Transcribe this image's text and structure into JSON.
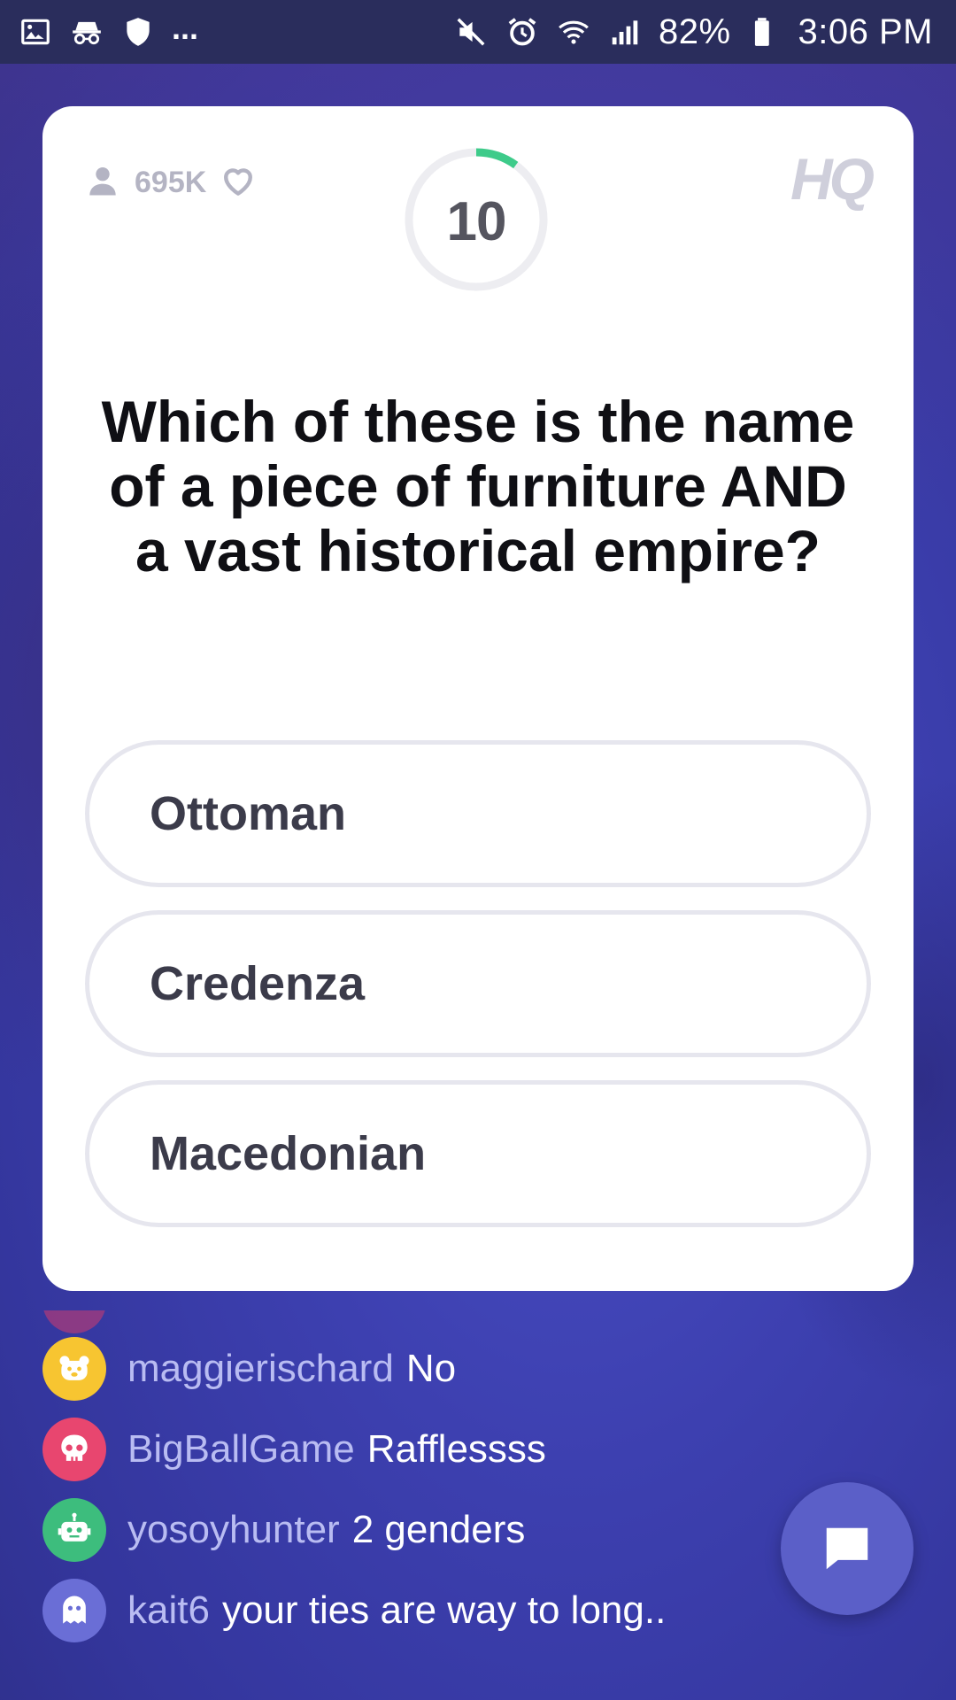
{
  "status_bar": {
    "icons_left": [
      "gallery-icon",
      "incognito-icon",
      "shield-icon"
    ],
    "overflow": "...",
    "icons_right": [
      "mute-icon",
      "alarm-icon",
      "wifi-icon",
      "signal-icon"
    ],
    "battery": "82%",
    "time": "3:06 PM"
  },
  "game": {
    "viewer_count": "695K",
    "timer": "10",
    "timer_progress": 0.1,
    "logo": "HQ",
    "accent_color": "#3ecb8a",
    "question": "Which of these is the name of a piece of furniture AND a vast historical empire?",
    "answers": [
      "Ottoman",
      "Credenza",
      "Macedonian"
    ]
  },
  "chat": {
    "messages": [
      {
        "user": "maggierischard",
        "text": "No",
        "avatar_color": "#f7c531",
        "avatar_icon": "bear-icon"
      },
      {
        "user": "BigBallGame",
        "text": "Rafflessss",
        "avatar_color": "#e8466f",
        "avatar_icon": "skull-icon"
      },
      {
        "user": "yosoyhunter",
        "text": "2 genders",
        "avatar_color": "#3dbd7d",
        "avatar_icon": "robot-icon"
      },
      {
        "user": "kait6",
        "text": "your ties are way to long..",
        "avatar_color": "#6a6ed6",
        "avatar_icon": "ghost-icon"
      }
    ]
  }
}
